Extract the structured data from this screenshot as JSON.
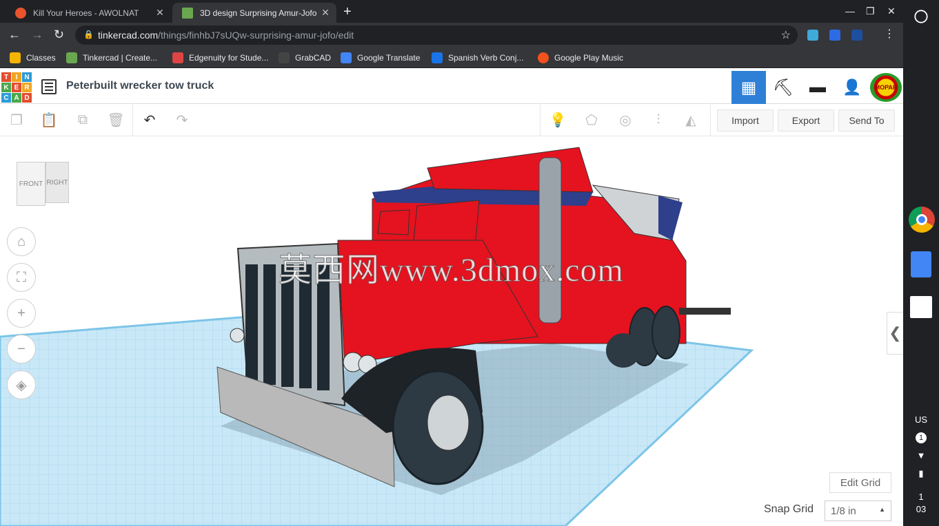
{
  "tabs": [
    {
      "title": "Kill Your Heroes - AWOLNAT",
      "close": "✕",
      "favicon_color": "#e8542e"
    },
    {
      "title": "3D design Surprising Amur-Jofo",
      "close": "✕",
      "favicon_color": "#6aa84f"
    }
  ],
  "new_tab": "+",
  "address": {
    "host": "tinkercad.com",
    "path": "/things/finhbJ7sUQw-surprising-amur-jofo/edit"
  },
  "bookmarks": [
    {
      "label": "Classes",
      "color": "#f4b400"
    },
    {
      "label": "Tinkercad | Create...",
      "color": "#6aa84f"
    },
    {
      "label": "Edgenuity for Stude...",
      "color": "#d44"
    },
    {
      "label": "GrabCAD",
      "color": "#444"
    },
    {
      "label": "Google Translate",
      "color": "#4285f4"
    },
    {
      "label": "Spanish Verb Conj...",
      "color": "#1a73e8"
    },
    {
      "label": "Google Play Music",
      "color": "#f4511e"
    }
  ],
  "app": {
    "logo_letters": [
      "T",
      "I",
      "N",
      "K",
      "E",
      "R",
      "C",
      "A",
      "D"
    ],
    "design_title": "Peterbuilt wrecker tow truck",
    "import_label": "Import",
    "export_label": "Export",
    "send_to_label": "Send To",
    "avatar_text": "MOPAR"
  },
  "viewcube": {
    "front": "FRONT",
    "right": "RIGHT"
  },
  "watermark": "莫西网www.3dmox.com",
  "edit_grid_label": "Edit Grid",
  "snap_grid": {
    "label": "Snap Grid",
    "value": "1/8 in"
  },
  "shelf": {
    "locale": "US",
    "badge": "1",
    "time_hour": "1",
    "time_min": "03"
  },
  "colors": {
    "accent": "#2e7fd6",
    "truck_red": "#e4131f",
    "grid_blue": "#bfe3f5"
  }
}
